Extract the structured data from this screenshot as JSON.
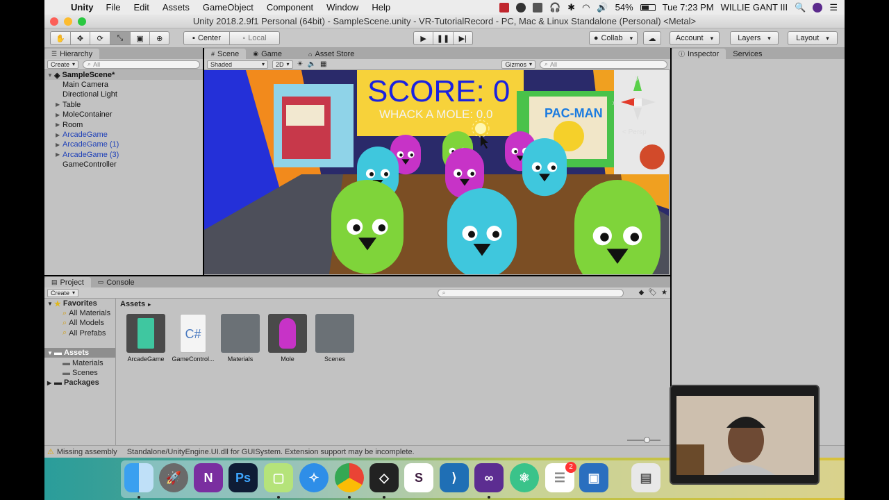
{
  "menubar": {
    "app_name": "Unity",
    "items": [
      "File",
      "Edit",
      "Assets",
      "GameObject",
      "Component",
      "Window",
      "Help"
    ],
    "battery": "54%",
    "clock": "Tue 7:23 PM",
    "user": "WILLIE GANT III"
  },
  "window": {
    "title": "Unity 2018.2.9f1 Personal (64bit) - SampleScene.unity - VR-TutorialRecord - PC, Mac & Linux Standalone (Personal) <Metal>"
  },
  "toolbar": {
    "pivot_center": "Center",
    "pivot_local": "Local",
    "collab": "Collab",
    "account": "Account",
    "layers": "Layers",
    "layout": "Layout"
  },
  "hierarchy": {
    "tab": "Hierarchy",
    "create": "Create",
    "search_placeholder": "All",
    "scene": "SampleScene*",
    "items": [
      {
        "label": "Main Camera",
        "expand": ""
      },
      {
        "label": "Directional Light",
        "expand": ""
      },
      {
        "label": "Table",
        "expand": "▶"
      },
      {
        "label": "MoleContainer",
        "expand": "▶"
      },
      {
        "label": "Room",
        "expand": "▶"
      },
      {
        "label": "ArcadeGame",
        "expand": "▶"
      },
      {
        "label": "ArcadeGame (1)",
        "expand": "▶"
      },
      {
        "label": "ArcadeGame (3)",
        "expand": "▶"
      },
      {
        "label": "GameController",
        "expand": ""
      }
    ]
  },
  "scene_tabs": {
    "scene": "Scene",
    "game": "Game",
    "asset_store": "Asset Store",
    "shading": "Shaded",
    "mode_2d": "2D",
    "gizmos": "Gizmos",
    "search_placeholder": "All"
  },
  "scene": {
    "score": "SCORE: 0",
    "subtitle": "WHACK A MOLE: 0.0",
    "persp": "< Persp",
    "gizmo_y": "y",
    "gizmo_x": "x",
    "poster_text": "PAC-MAN"
  },
  "inspector": {
    "tab": "Inspector",
    "services": "Services"
  },
  "project": {
    "tab": "Project",
    "console": "Console",
    "create": "Create",
    "favorites": "Favorites",
    "fav_items": [
      "All Materials",
      "All Models",
      "All Prefabs"
    ],
    "assets_root": "Assets",
    "asset_children": [
      "Materials",
      "Scenes"
    ],
    "packages": "Packages",
    "breadcrumb": "Assets",
    "grid": [
      {
        "label": "ArcadeGame",
        "kind": "prefab"
      },
      {
        "label": "GameControl...",
        "kind": "script"
      },
      {
        "label": "Materials",
        "kind": "folder"
      },
      {
        "label": "Mole",
        "kind": "prefab"
      },
      {
        "label": "Scenes",
        "kind": "folder"
      }
    ],
    "script_glyph": "C#"
  },
  "status": {
    "left": "Missing assembly",
    "message": "Standalone/UnityEngine.UI.dll for GUISystem. Extension support may be incomplete."
  },
  "dock": {
    "badge": "2",
    "icons": [
      "Finder",
      "Launchpad",
      "OneNote",
      "Photoshop",
      "Messages",
      "Safari",
      "Chrome",
      "Unity",
      "Slack",
      "VS Code",
      "Visual Studio",
      "Atom",
      "Reminders",
      "VirtualBox",
      "Preview"
    ],
    "glyphs": {
      "onenote": "N",
      "photoshop": "Ps",
      "slack": "S"
    }
  },
  "colors": {
    "score_text": "#1a22e0",
    "accent_blue": "#1d3fb8",
    "mole_green": "#7fd43a",
    "mole_cyan": "#3fc7dd",
    "mole_magenta": "#c733c7"
  }
}
